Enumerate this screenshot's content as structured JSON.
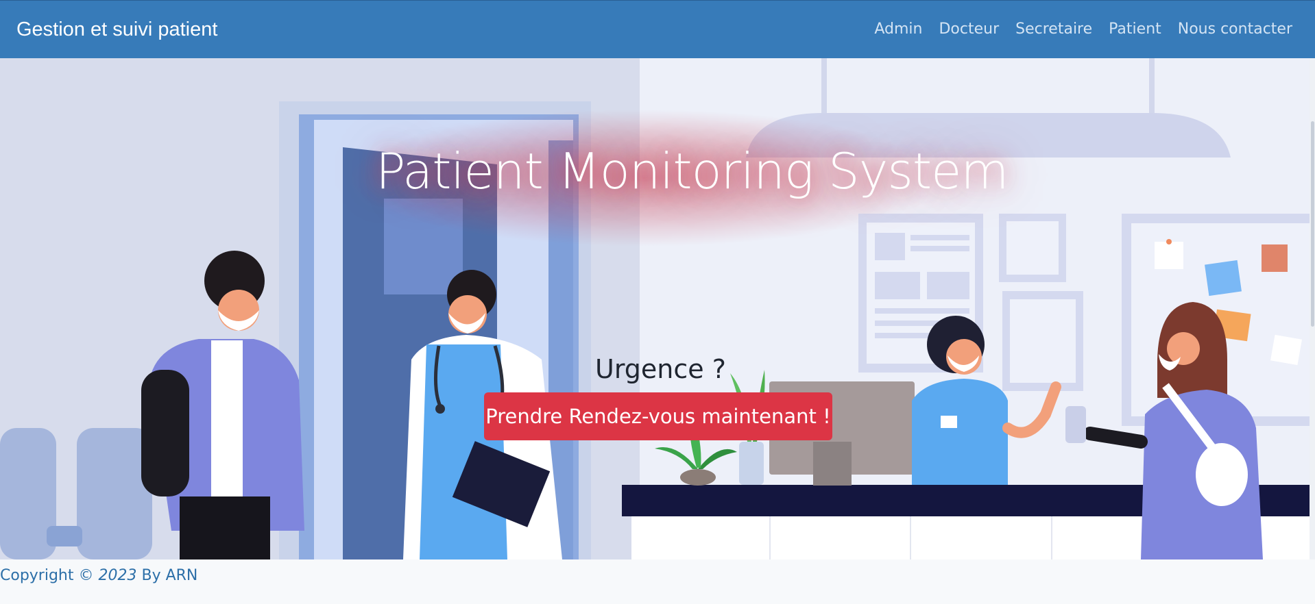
{
  "navbar": {
    "brand": "Gestion et suivi patient",
    "links": [
      "Admin",
      "Docteur",
      "Secretaire",
      "Patient",
      "Nous contacter"
    ]
  },
  "hero": {
    "title": "Patient Monitoring System",
    "question": "Urgence ?",
    "cta_label": "Prendre Rendez-vous maintenant !"
  },
  "footer": {
    "prefix": "Copyright © ",
    "year": "2023",
    "suffix": " By ARN"
  },
  "colors": {
    "navbar": "#377bb9",
    "cta": "#dc3545",
    "footer_text": "#2c6fa8"
  }
}
